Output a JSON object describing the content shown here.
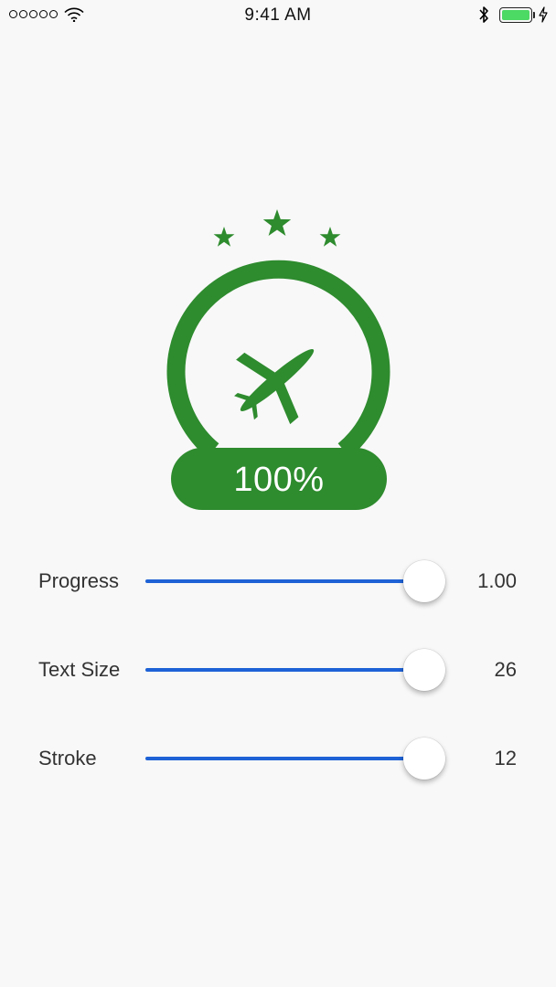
{
  "status_bar": {
    "time": "9:41 AM",
    "signal_icon": "signal-dots-icon",
    "wifi_icon": "wifi-icon",
    "bluetooth_icon": "bluetooth-icon",
    "battery_icon": "battery-icon",
    "battery_level": 1.0,
    "charging_icon": "charging-bolt-icon"
  },
  "badge": {
    "progress_text": "100%",
    "progress": 1.0,
    "stars": 3,
    "icon": "airplane-icon",
    "color": "#2e8b2e"
  },
  "controls": [
    {
      "label": "Progress",
      "value": "1.00",
      "fraction": 1.0
    },
    {
      "label": "Text Size",
      "value": "26",
      "fraction": 1.0
    },
    {
      "label": "Stroke",
      "value": "12",
      "fraction": 1.0
    }
  ],
  "colors": {
    "accent": "#1e62d6",
    "badge_green": "#2e8b2e",
    "battery_green": "#4cd964"
  }
}
